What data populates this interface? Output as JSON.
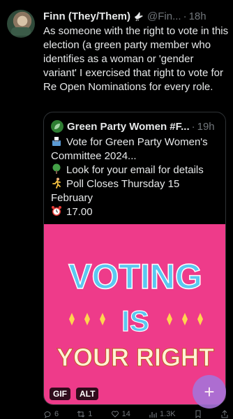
{
  "tweet": {
    "author_name": "Finn (They/Them)",
    "author_handle": "@Fin...",
    "separator": "·",
    "time": "18h",
    "text": "As someone with the right to vote in this election (a green party member who identifies as a woman or 'gender variant' I exercised that right to vote for Re Open Nominations for every role."
  },
  "quote": {
    "author_name": "Green Party Women #F...",
    "separator": "·",
    "time": "19h",
    "lines": [
      {
        "icon": "ballot-box-icon",
        "text": "Vote for Green Party Women's Committee 2024..."
      },
      {
        "icon": "tree-icon",
        "text": "Look for your email for details"
      },
      {
        "icon": "running-person-icon",
        "text": "Poll Closes Thursday 15 February"
      },
      {
        "icon": "alarm-clock-icon",
        "text": "17.00"
      }
    ],
    "media": {
      "line1": "VOTING",
      "line2": "IS",
      "line3": "YOUR RIGHT",
      "gif_badge": "GIF",
      "alt_badge": "ALT",
      "background": "#ee3b8a"
    }
  },
  "actions": {
    "replies": "6",
    "retweets": "1",
    "likes": "14",
    "views": "1.3K"
  },
  "fab": {
    "label": "+"
  }
}
